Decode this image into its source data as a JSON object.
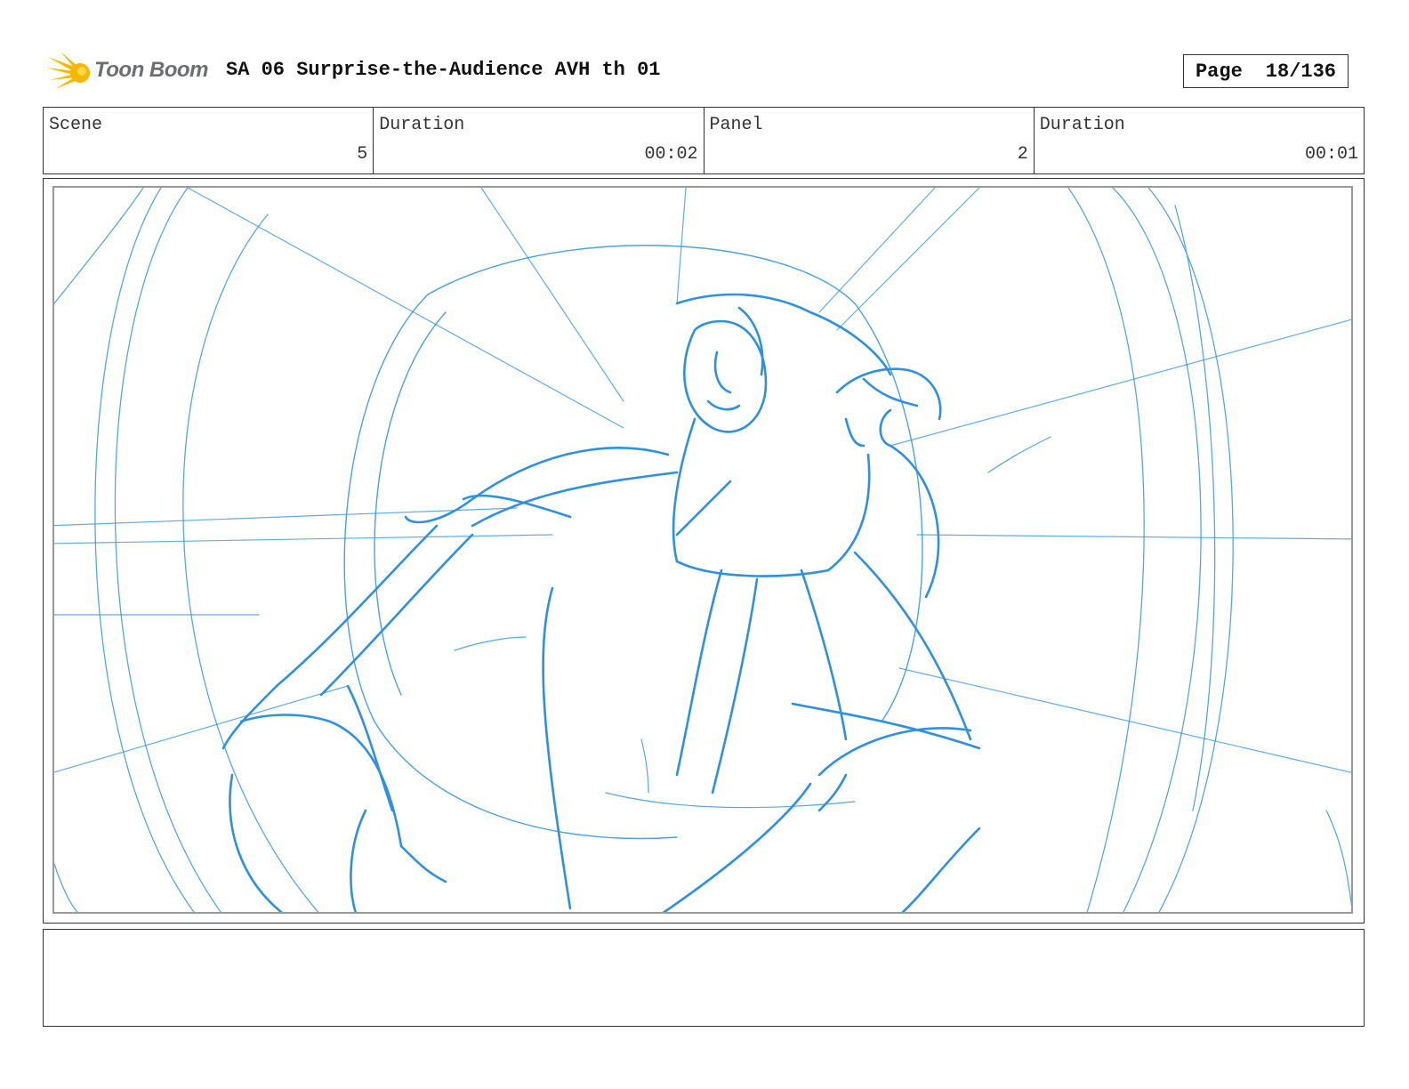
{
  "header": {
    "logo_text": "Toon Boom",
    "title": "SA 06 Surprise-the-Audience AVH th 01",
    "page_label": "Page",
    "page_value": "18/136"
  },
  "info": {
    "scene_label": "Scene",
    "scene_value": "5",
    "scene_duration_label": "Duration",
    "scene_duration_value": "00:02",
    "panel_label": "Panel",
    "panel_value": "2",
    "panel_duration_label": "Duration",
    "panel_duration_value": "00:01"
  },
  "colors": {
    "sketch_blue": "#2f8fe0",
    "logo_yellow": "#f5b800",
    "logo_text": "#6d6e71"
  },
  "caption": ""
}
